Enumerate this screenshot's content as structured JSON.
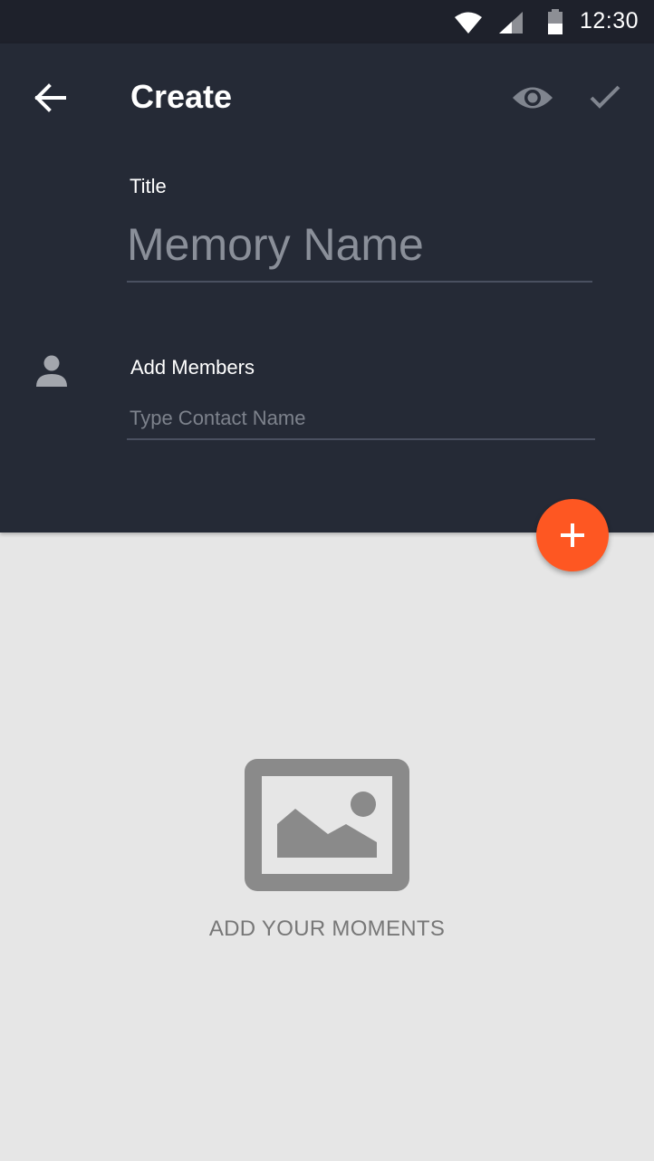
{
  "status_bar": {
    "time": "12:30",
    "icons": [
      "wifi-icon",
      "signal-icon",
      "battery-icon"
    ]
  },
  "header": {
    "title": "Create",
    "back_icon": "arrow-back-icon",
    "preview_icon": "eye-icon",
    "confirm_icon": "check-icon"
  },
  "form": {
    "title_label": "Title",
    "title_placeholder": "Memory Name",
    "title_value": "",
    "members_icon": "person-icon",
    "members_label": "Add Members",
    "members_placeholder": "Type Contact Name",
    "members_value": ""
  },
  "fab": {
    "icon": "plus-icon"
  },
  "empty_state": {
    "icon": "image-icon",
    "text": "ADD YOUR MOMENTS"
  },
  "colors": {
    "status_bar": "#1e212b",
    "header": "#252a36",
    "accent": "#fe5722",
    "background": "#e6e6e6",
    "empty_icon": "#8a8a8a"
  }
}
